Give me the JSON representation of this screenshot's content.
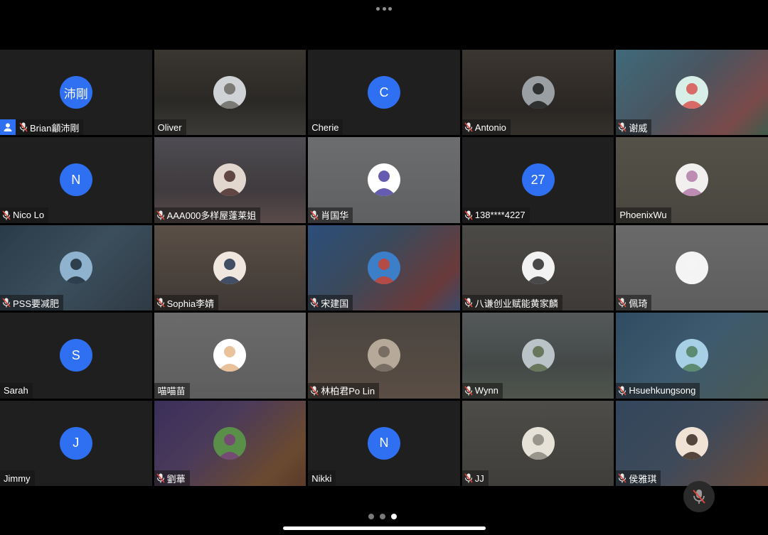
{
  "participants": [
    {
      "name": "Brian龥沛剛",
      "muted": true,
      "host": true,
      "avatar": "text",
      "avatar_text": "沛剛",
      "bg": "#1f1f1f"
    },
    {
      "name": "Oliver",
      "muted": false,
      "avatar": "photo",
      "avatar_icon": "silhouette-sunset-photo-icon",
      "photo_colors": [
        "#cfd3d6",
        "#6d6a64"
      ],
      "bg": "linear-gradient(180deg,#3a3630,#2b2926 60%,#3c3a36)"
    },
    {
      "name": "Cherie",
      "muted": false,
      "avatar": "letter",
      "avatar_text": "C",
      "bg": "#1f1f1f"
    },
    {
      "name": "Antonio",
      "muted": true,
      "avatar": "photo",
      "avatar_icon": "person-at-window-photo-icon",
      "photo_colors": [
        "#9a9fa3",
        "#1c1c1c"
      ],
      "bg": "linear-gradient(180deg,#3b3630,#2a2623 70%,#34302b)"
    },
    {
      "name": "谢威",
      "muted": true,
      "avatar": "photo",
      "avatar_icon": "cartoon-character-photo-icon",
      "photo_colors": [
        "#d7efe6",
        "#d9534f"
      ],
      "bg": "linear-gradient(135deg,#3f6a7b,#4a5560 45%,#7a4a4a 80%,#3e5b4b)"
    },
    {
      "name": "Nico Lo",
      "muted": true,
      "avatar": "letter",
      "avatar_text": "N",
      "bg": "#1f1f1f"
    },
    {
      "name": "AAA000多样屋蓬莱姐",
      "muted": true,
      "avatar": "photo",
      "avatar_icon": "woman-portrait-photo-icon",
      "photo_colors": [
        "#e2d7cf",
        "#4a2e2a"
      ],
      "bg": "linear-gradient(180deg,#4e4c52,#3f3b3e 60%,#5a4a4a)"
    },
    {
      "name": "肖国华",
      "muted": true,
      "avatar": "photo",
      "avatar_icon": "triangle-logo-photo-icon",
      "photo_colors": [
        "#ffffff",
        "#4a3fa2"
      ],
      "bg": "linear-gradient(180deg,#6b6d6f,#5e6062)"
    },
    {
      "name": "138****4227",
      "muted": true,
      "avatar": "letter",
      "avatar_text": "27",
      "bg": "#1f1f1f"
    },
    {
      "name": "PhoenixWu",
      "muted": false,
      "avatar": "photo",
      "avatar_icon": "white-cat-photo-icon",
      "photo_colors": [
        "#f2f0ee",
        "#b37aa8"
      ],
      "bg": "linear-gradient(180deg,#545248,#48463e)"
    },
    {
      "name": "PSS要减肥",
      "muted": true,
      "avatar": "photo",
      "avatar_icon": "person-by-lake-photo-icon",
      "photo_colors": [
        "#8fb3cf",
        "#1d2b36"
      ],
      "bg": "linear-gradient(135deg,#2a3a48,#3b4e5c 50%,#2f3a44)"
    },
    {
      "name": "Sophia李婧",
      "muted": true,
      "avatar": "photo",
      "avatar_icon": "woman-portrait-photo-icon",
      "photo_colors": [
        "#f0e7df",
        "#23334d"
      ],
      "bg": "linear-gradient(180deg,#5a4f46,#3f3834)"
    },
    {
      "name": "宋建国",
      "muted": true,
      "avatar": "photo",
      "avatar_icon": "mountain-group-photo-icon",
      "photo_colors": [
        "#3c7ec8",
        "#c9422f"
      ],
      "bg": "linear-gradient(135deg,#2b4e7a,#3a4a5c 40%,#6a3a3a 80%,#3a4a6a)"
    },
    {
      "name": "八谦创业赋能黄家麟",
      "muted": true,
      "avatar": "photo",
      "avatar_icon": "man-portrait-photo-icon",
      "photo_colors": [
        "#f2f2f2",
        "#2c2c2c"
      ],
      "bg": "linear-gradient(180deg,#4c4a47,#3d3a37)"
    },
    {
      "name": "佩琦",
      "muted": true,
      "avatar": "photo",
      "avatar_icon": "white-circle-photo-icon",
      "photo_colors": [
        "#f4f4f4",
        "#f4f4f4"
      ],
      "bg": "linear-gradient(180deg,#6a6a6a,#5d5d5d)"
    },
    {
      "name": "Sarah",
      "muted": false,
      "avatar": "letter",
      "avatar_text": "S",
      "bg": "#1f1f1f"
    },
    {
      "name": "喵喵苗",
      "muted": false,
      "avatar": "photo",
      "avatar_icon": "cartoon-sticker-photo-icon",
      "photo_colors": [
        "#ffffff",
        "#e5b68a"
      ],
      "bg": "linear-gradient(180deg,#6b6b6b,#5d5d5d)"
    },
    {
      "name": "林柏君Po Lin",
      "muted": true,
      "avatar": "photo",
      "avatar_icon": "portrait-photo-icon",
      "photo_colors": [
        "#b7a99a",
        "#6e6459"
      ],
      "bg": "linear-gradient(180deg,#4a4540,#5a4d44)"
    },
    {
      "name": "Wynn",
      "muted": true,
      "avatar": "photo",
      "avatar_icon": "man-outdoors-photo-icon",
      "photo_colors": [
        "#b9c3c8",
        "#5a6b4a"
      ],
      "bg": "linear-gradient(180deg,#55595a,#444948 60%,#4f554c)"
    },
    {
      "name": "Hsuehkungsong",
      "muted": true,
      "avatar": "photo",
      "avatar_icon": "coastline-photo-icon",
      "photo_colors": [
        "#a7cfe6",
        "#4f7f5c"
      ],
      "bg": "linear-gradient(135deg,#2f4c62,#3e5a6e 50%,#4a5a56)"
    },
    {
      "name": "Jimmy",
      "muted": false,
      "avatar": "letter",
      "avatar_text": "J",
      "bg": "#1f1f1f"
    },
    {
      "name": "劉華",
      "muted": true,
      "avatar": "photo",
      "avatar_icon": "colorful-blocks-photo-icon",
      "photo_colors": [
        "#5a8f4a",
        "#7a3f7a"
      ],
      "bg": "linear-gradient(135deg,#3a2f5a,#4b3a5a 40%,#6a4a2f 80%,#5a3a2a)"
    },
    {
      "name": "Nikki",
      "muted": false,
      "avatar": "letter",
      "avatar_text": "N",
      "bg": "#1f1f1f"
    },
    {
      "name": "JJ",
      "muted": true,
      "avatar": "photo",
      "avatar_icon": "sketch-drawing-photo-icon",
      "photo_colors": [
        "#e6e2d8",
        "#8a877f"
      ],
      "bg": "linear-gradient(180deg,#4e4c48,#403e3a)"
    },
    {
      "name": "侯雅琪",
      "muted": true,
      "avatar": "photo",
      "avatar_icon": "woman-portrait-photo-icon",
      "photo_colors": [
        "#f0e2d4",
        "#3a2a22"
      ],
      "bg": "linear-gradient(135deg,#33465c,#3e4a5a 50%,#6a4a3a)"
    }
  ],
  "controls": {
    "more_icon": "more-horizontal-icon",
    "mic_icon": "microphone-muted-icon"
  },
  "pagination": {
    "pages": 3,
    "current": 3
  },
  "colors": {
    "accent": "#2f6ff1",
    "background": "#000000"
  }
}
